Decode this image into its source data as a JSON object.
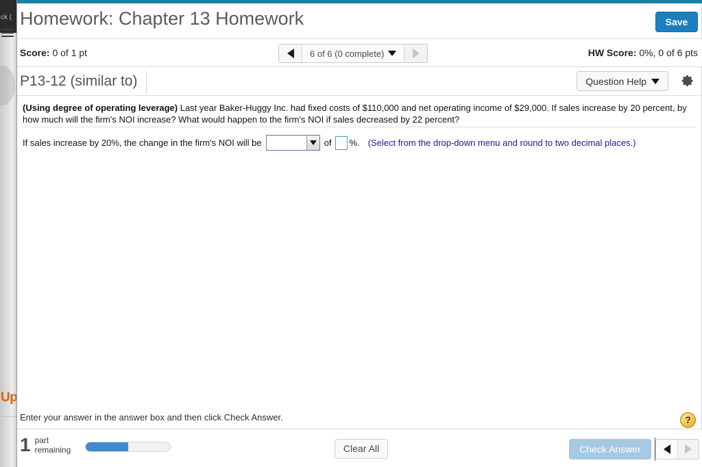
{
  "browser_chrome": {
    "dark_tab_text": "ck (",
    "orange_text": "Up"
  },
  "header": {
    "title": "Homework: Chapter 13 Homework",
    "save_label": "Save",
    "teal_accent": "#1a7ea8",
    "save_color": "#1a7fc1"
  },
  "score_bar": {
    "score_label": "Score:",
    "score_value": "0 of 1 pt",
    "pager_label": "6 of 6 (0 complete)",
    "prev_icon": "triangle-left-icon",
    "next_icon": "triangle-right-icon",
    "dropdown_icon": "chevron-down-icon",
    "hw_score_label": "HW Score:",
    "hw_score_value": "0%, 0 of 6 pts"
  },
  "question_header": {
    "question_id": "P13-12 (similar to)",
    "question_help_label": "Question Help",
    "help_dropdown_icon": "chevron-down-icon",
    "settings_icon": "gear-icon"
  },
  "question": {
    "bold_lead": "(Using degree of operating leverage)",
    "statement": " Last year Baker-Huggy Inc. had fixed costs of $110,000 and net operating income of $29,000. If sales increase by 20 percent, by how much will the firm's NOI increase? What would happen to the firm's NOI if sales decreased by 22 percent?"
  },
  "answer_row": {
    "prompt": "If sales increase by 20%, the change in the firm's NOI will be",
    "dropdown_value": "",
    "dropdown_icon": "triangle-down-icon",
    "of_label": "of",
    "numeric_value": "",
    "percent_label": "%.",
    "hint": "(Select from the drop-down menu and round to two decimal places.)",
    "hint_color": "#18189e",
    "dropdown_border": "#6b6bc4",
    "input_border": "#3aa5b5"
  },
  "footer": {
    "instruction": "Enter your answer in the answer box and then click Check Answer.",
    "help_icon": "question-mark-icon",
    "parts_count": "1",
    "parts_line1": "part",
    "parts_line2": "remaining",
    "progress_percent": 50,
    "progress_color": "#4189ca",
    "clear_all_label": "Clear All",
    "check_answer_label": "Check Answer",
    "check_answer_color": "#a5c8e3",
    "prev_icon": "triangle-left-icon",
    "next_icon": "triangle-right-icon"
  }
}
